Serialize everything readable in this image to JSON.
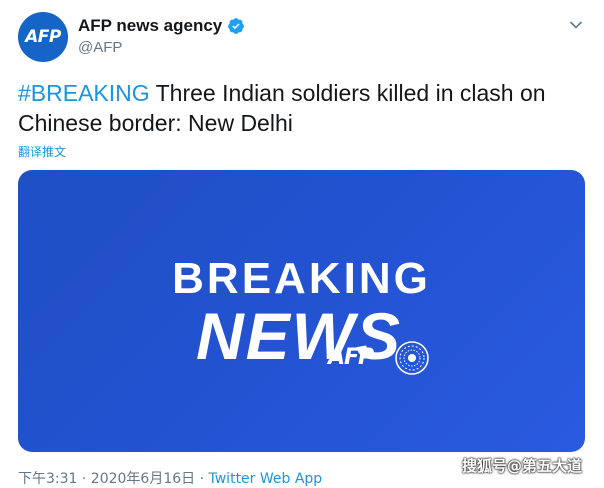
{
  "account": {
    "avatar_text": "AFP",
    "display_name": "AFP news agency",
    "handle": "@AFP",
    "avatar_color": "#1565c6"
  },
  "tweet": {
    "hashtag": "#BREAKING",
    "text": " Three Indian soldiers killed in clash on Chinese border: New Delhi",
    "translate_label": "翻译推文"
  },
  "media": {
    "line1": "BREAKING",
    "line2": "NEWS",
    "brand": "AFP",
    "background_color": "#2352d0"
  },
  "footer": {
    "timestamp": "下午3:31 · 2020年6月16日 · ",
    "app": "Twitter Web App"
  },
  "watermark": "搜狐号@第五大道",
  "colors": {
    "link": "#1b95e0",
    "secondary_text": "#657786"
  },
  "icons": [
    "verified-badge-icon",
    "caret-down-icon",
    "globe-icon"
  ]
}
